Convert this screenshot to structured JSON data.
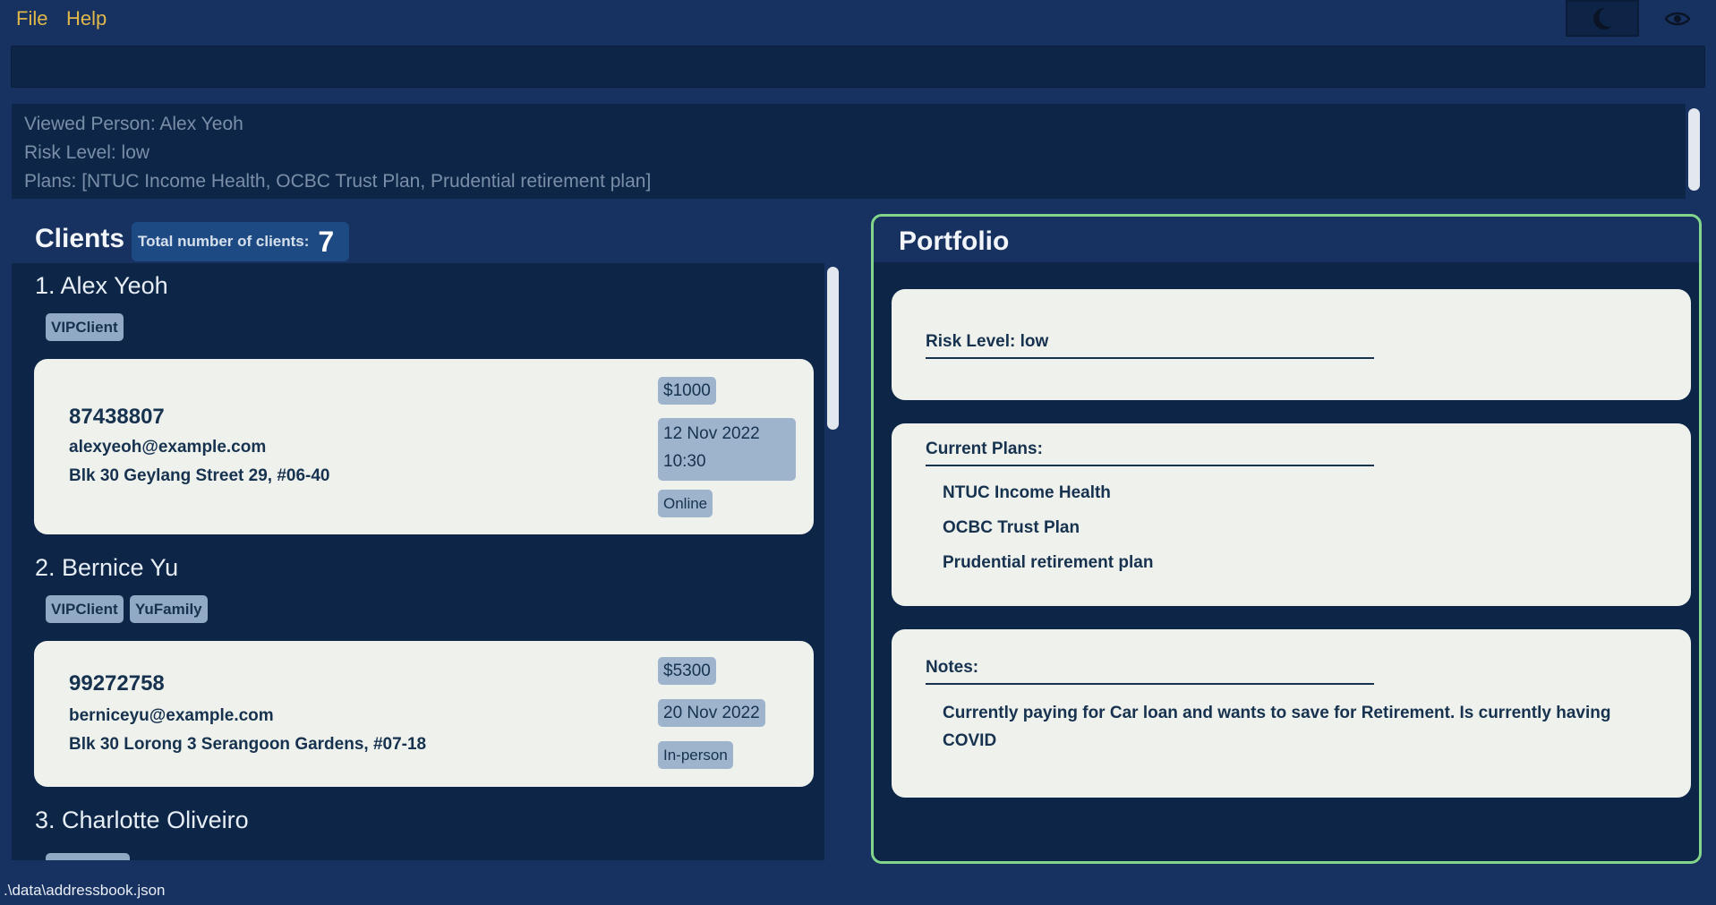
{
  "menu": {
    "file": "File",
    "help": "Help"
  },
  "theme_icons": {
    "dark_mode": "moon-icon",
    "eye": "eye-icon"
  },
  "command_box": {
    "value": ""
  },
  "result": {
    "line1": "Viewed Person: Alex Yeoh",
    "line2": "Risk Level: low",
    "line3": "Plans: [NTUC Income Health, OCBC Trust Plan, Prudential retirement plan]"
  },
  "clients": {
    "title": "Clients",
    "total_label": "Total number of clients:",
    "total_value": "7",
    "items": [
      {
        "name": "1.  Alex Yeoh",
        "tags": [
          "VIPClient"
        ],
        "phone": "87438807",
        "email": "alexyeoh@example.com",
        "address": "Blk 30 Geylang Street 29, #06-40",
        "amount": "$1000",
        "date_line1": "12 Nov 2022",
        "date_line2": "10:30",
        "mode": "Online"
      },
      {
        "name": "2.  Bernice Yu",
        "tags": [
          "VIPClient",
          "YuFamily"
        ],
        "phone": "99272758",
        "email": "berniceyu@example.com",
        "address": "Blk 30 Lorong 3 Serangoon Gardens, #07-18",
        "amount": "$5300",
        "date_line1": "20 Nov 2022",
        "mode": "In-person"
      },
      {
        "name": "3.  Charlotte Oliveiro"
      }
    ]
  },
  "portfolio": {
    "title": "Portfolio",
    "risk_level": "Risk Level: low",
    "plans_heading": "Current Plans:",
    "plans": [
      "NTUC Income Health",
      "OCBC Trust Plan",
      "Prudential retirement plan"
    ],
    "notes_heading": "Notes:",
    "notes": "Currently paying for Car loan and wants to save for Retirement. Is currently having COVID"
  },
  "status_bar": {
    "path": ".\\data\\addressbook.json"
  },
  "colors": {
    "background": "#173160",
    "panel": "#0d2647",
    "card": "#eef1ec",
    "menu_text": "#e0b84a",
    "portfolio_border": "#82d68c",
    "tag": "#92a9c5"
  }
}
